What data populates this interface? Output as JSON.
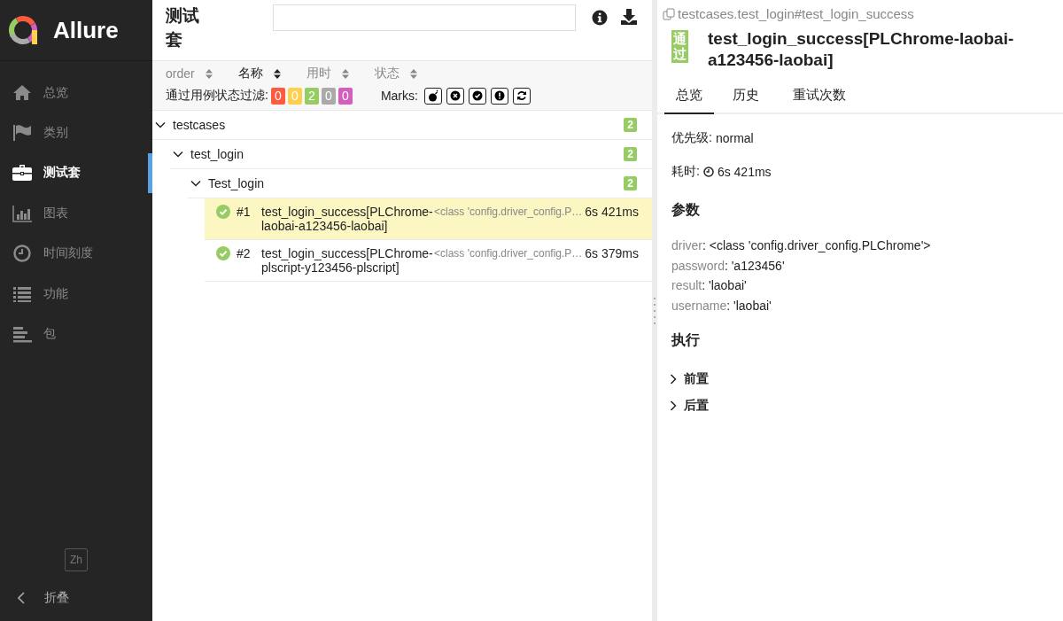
{
  "app": {
    "name": "Allure"
  },
  "sidebar": {
    "items": [
      {
        "label": "总览",
        "kind": "home",
        "selected": false
      },
      {
        "label": "类别",
        "kind": "flag",
        "selected": false
      },
      {
        "label": "测试套",
        "kind": "briefcase",
        "selected": true
      },
      {
        "label": "图表",
        "kind": "chart",
        "selected": false
      },
      {
        "label": "时间刻度",
        "kind": "clock",
        "selected": false
      },
      {
        "label": "功能",
        "kind": "list",
        "selected": false
      },
      {
        "label": "包",
        "kind": "lines",
        "selected": false
      }
    ],
    "language": "Zh",
    "collapse": "折叠"
  },
  "suites": {
    "title": "测试套",
    "sort": [
      {
        "label": "order",
        "selected": false
      },
      {
        "label": "名称",
        "selected": true
      },
      {
        "label": "用时",
        "selected": false
      },
      {
        "label": "状态",
        "selected": false
      }
    ],
    "filter": {
      "label": "通过用例状态过滤:",
      "counts": [
        {
          "value": "0",
          "color": "#fd5a3e"
        },
        {
          "value": "0",
          "color": "#ffd050"
        },
        {
          "value": "2",
          "color": "#97cc64"
        },
        {
          "value": "0",
          "color": "#aaaaaa"
        },
        {
          "value": "0",
          "color": "#d35ebe"
        }
      ]
    },
    "marks": {
      "label": "Marks:",
      "buttons": [
        {
          "kind": "bomb"
        },
        {
          "kind": "cross"
        },
        {
          "kind": "check"
        },
        {
          "kind": "exclamation"
        },
        {
          "kind": "retry"
        }
      ]
    },
    "tree": [
      {
        "name": "testcases",
        "count": "2",
        "expanded": true,
        "children": [
          {
            "name": "test_login",
            "count": "2",
            "expanded": true,
            "children": [
              {
                "name": "Test_login",
                "count": "2",
                "expanded": true,
                "tests": [
                  {
                    "index": "#1",
                    "name": "test_login_success[PLChrome-laobai-a123456-laobai]",
                    "param": "<class 'config.driver_config.P…",
                    "duration": "6s 421ms",
                    "kind": "passed",
                    "selected": true
                  },
                  {
                    "index": "#2",
                    "name": "test_login_success[PLChrome-plscript-y123456-plscript]",
                    "param": "<class 'config.driver_config.P…",
                    "duration": "6s 379ms",
                    "kind": "passed",
                    "selected": false
                  }
                ]
              }
            ]
          }
        ]
      }
    ]
  },
  "detail": {
    "path": "testcases.test_login#test_login_success",
    "status": "通过",
    "title": "test_login_success[PLChrome-laobai-a123456-laobai]",
    "tabs": [
      {
        "label": "总览",
        "selected": true
      },
      {
        "label": "历史",
        "selected": false
      },
      {
        "label": "重试次数",
        "selected": false
      }
    ],
    "priority_label": "优先级:",
    "priority": "normal",
    "duration_label": "耗时:",
    "duration": "6s 421ms",
    "params_heading": "参数",
    "params": [
      {
        "name": "driver",
        "value": ": <class 'config.driver_config.PLChrome'>"
      },
      {
        "name": "password",
        "value": ": 'a123456'"
      },
      {
        "name": "result",
        "value": ": 'laobai'"
      },
      {
        "name": "username",
        "value": ": 'laobai'"
      }
    ],
    "execution_heading": "执行",
    "stages": [
      {
        "label": "前置",
        "expanded": false
      },
      {
        "label": "后置",
        "expanded": false
      }
    ]
  }
}
